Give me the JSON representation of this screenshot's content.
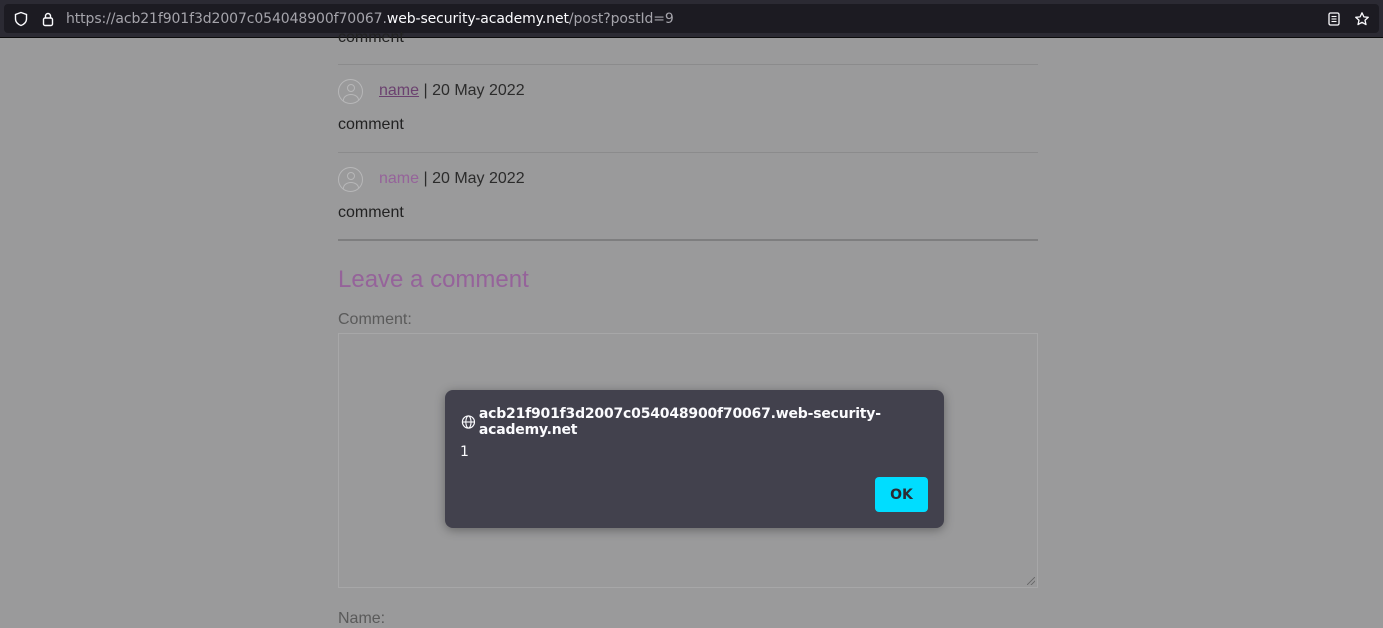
{
  "browser": {
    "url_prefix": "https://acb21f901f3d2007c054048900f70067.",
    "url_host": "web-security-academy.net",
    "url_path": "/post?postId=9"
  },
  "comments": [
    {
      "author": "name",
      "date": "| 20 May 2022",
      "text": "comment"
    },
    {
      "author": "name",
      "date": "| 20 May 2022",
      "text": "comment"
    }
  ],
  "truncated_comment": "comment",
  "form": {
    "title": "Leave a comment",
    "comment_label": "Comment:",
    "name_label": "Name:"
  },
  "dialog": {
    "origin": "acb21f901f3d2007c054048900f70067.web-security-academy.net",
    "message": "1",
    "ok_label": "OK",
    "ok_color": "#00ddff"
  }
}
